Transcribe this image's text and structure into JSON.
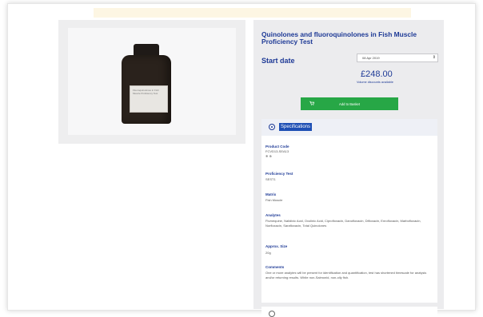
{
  "product": {
    "title": "Quinolones and fluoroquinolones in Fish Muscle Proficiency Test",
    "image_label": "Fluoroquinolones in Fish Muscle Proficiency Test"
  },
  "purchase": {
    "start_label": "Start date",
    "start_date_value": "08 Apr 2019",
    "price": "£248.00",
    "discount_link": "Volume discounts available",
    "basket_label": "Add to Basket"
  },
  "specifications": {
    "header": "Specifications",
    "product_code_label": "Product Code",
    "product_code_value": "FCVD13-SEA13",
    "product_code_icons": "❄ ⊕",
    "proficiency_label": "Proficiency Test",
    "proficiency_value": "SEST1",
    "matrix_label": "Matrix",
    "matrix_value": "Fish Muscle",
    "analytes_label": "Analytes",
    "analytes_value": "Flumequine, Nalidixic Acid, Oxolinic Acid, Ciprofloxacin, Danofloxacin, Difloxacin, Enrofloxacin, Marbofloxacin, Norfloxacin, Sarafloxacin, Total Quinolones",
    "size_label": "Approx. Size",
    "size_value": "20g",
    "comments_label": "Comments",
    "comments_value": "One or more analytes will be present for identification and quantification, test has shortened timescale for analysis and/or returning results. White non-Salmonid, non-oily fish."
  },
  "colors": {
    "brand_blue": "#1e3a96",
    "button_green": "#27a746"
  }
}
